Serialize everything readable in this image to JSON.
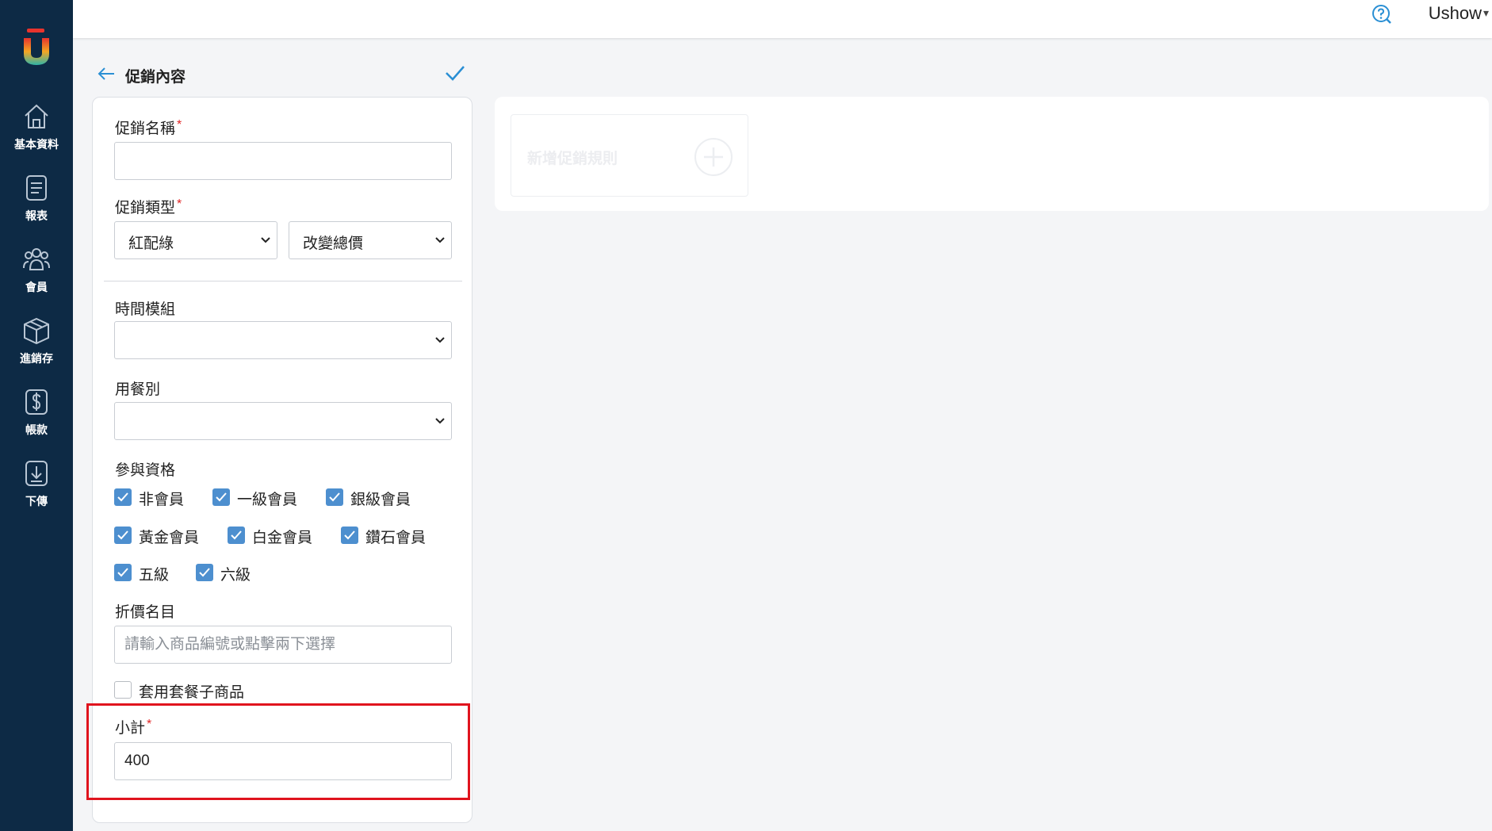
{
  "sidebar": {
    "items": [
      {
        "label": "基本資料",
        "icon": "home-icon"
      },
      {
        "label": "報表",
        "icon": "report-icon"
      },
      {
        "label": "會員",
        "icon": "members-icon"
      },
      {
        "label": "進銷存",
        "icon": "inventory-box-icon"
      },
      {
        "label": "帳款",
        "icon": "dollar-icon"
      },
      {
        "label": "下傳",
        "icon": "download-icon"
      }
    ]
  },
  "topbar": {
    "user_name": "Ushow",
    "caret": "▾",
    "help_icon": "help-icon"
  },
  "page": {
    "title": "促銷內容"
  },
  "form": {
    "promo_name": {
      "label": "促銷名稱",
      "value": ""
    },
    "promo_type": {
      "label": "促銷類型",
      "value1": "紅配綠",
      "value2": "改變總價"
    },
    "time_module": {
      "label": "時間模組",
      "value": ""
    },
    "meal_type": {
      "label": "用餐別",
      "value": ""
    },
    "eligibility": {
      "label": "參與資格",
      "options": [
        {
          "label": "非會員",
          "checked": true
        },
        {
          "label": "一級會員",
          "checked": true
        },
        {
          "label": "銀級會員",
          "checked": true
        },
        {
          "label": "黃金會員",
          "checked": true
        },
        {
          "label": "白金會員",
          "checked": true
        },
        {
          "label": "鑽石會員",
          "checked": true
        },
        {
          "label": "五級",
          "checked": true
        },
        {
          "label": "六級",
          "checked": true
        }
      ]
    },
    "discount_items": {
      "label": "折價名目",
      "placeholder": "請輸入商品編號或點擊兩下選擇"
    },
    "apply_combo": {
      "label": "套用套餐子商品",
      "checked": false
    },
    "subtotal": {
      "label": "小計",
      "value": "400"
    },
    "required_mark": "*"
  },
  "rules": {
    "add_label": "新增促銷規則"
  },
  "colors": {
    "sidebar": "#0d2a45",
    "accent": "#4d8fcf",
    "required": "#e02424",
    "highlight": "#e0141e"
  }
}
